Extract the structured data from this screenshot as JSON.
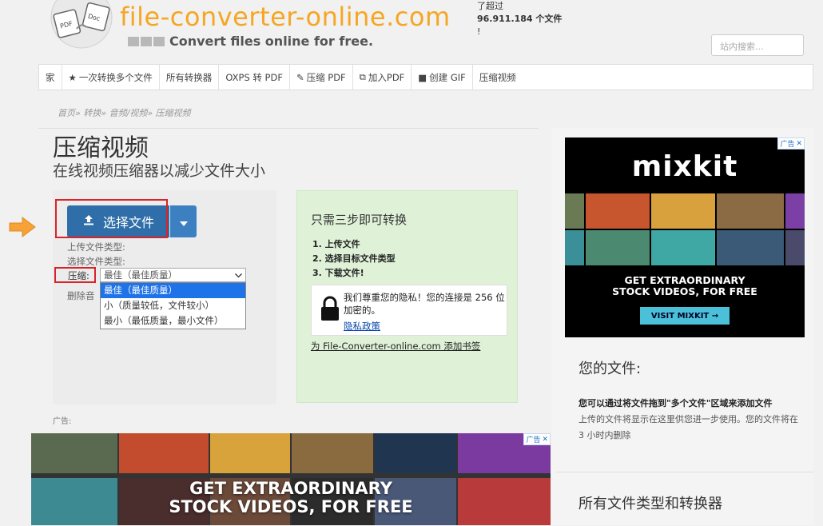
{
  "header": {
    "site_name": "file-converter-online.com",
    "tagline": "Convert files online for free.",
    "stats_line1": "了超过",
    "stats_line2": "96.911.184 个文件",
    "stats_line3": "!",
    "search_placeholder": "站内搜索...",
    "logo_badge_left": "PDF",
    "logo_badge_right": "Doc"
  },
  "nav": {
    "items": [
      {
        "label": "家",
        "icon": ""
      },
      {
        "label": "一次转换多个文件",
        "icon": "star-icon"
      },
      {
        "label": "所有转换器",
        "icon": ""
      },
      {
        "label": "OXPS 转 PDF",
        "icon": ""
      },
      {
        "label": "压缩 PDF",
        "icon": "pin-icon"
      },
      {
        "label": "加入PDF",
        "icon": "copy-icon"
      },
      {
        "label": "创建 GIF",
        "icon": "video-icon"
      },
      {
        "label": "压缩视频",
        "icon": ""
      }
    ]
  },
  "breadcrumb": "首页» 转换» 音频/视频» 压缩视频",
  "main": {
    "title": "压缩视频",
    "subtitle": "在线视频压缩器以减少文件大小",
    "upload_label": "选择文件",
    "upload_file_type_label": "上传文件类型:",
    "target_file_type_label": "选择文件类型:",
    "compress_label": "压缩:",
    "compress_selected": "最佳（最佳质量）",
    "remove_audio_label": "删除音",
    "compress_options": [
      "最佳（最佳质量）",
      "小（质量较低，文件较小）",
      "最小（最低质量，最小文件）"
    ],
    "ad_label": "广告:"
  },
  "steps": {
    "title": "只需三步即可转换",
    "items": [
      "1. 上传文件",
      "2. 选择目标文件类型",
      "3. 下载文件!"
    ],
    "privacy_text": "我们尊重您的隐私！您的连接是 256 位加密的。",
    "privacy_link": "隐私政策",
    "bookmark_link": "为 File-Converter-online.com 添加书签"
  },
  "bottom_ad": {
    "badge": "广告",
    "headline_line1": "GET EXTRAORDINARY",
    "headline_line2": "STOCK VIDEOS, FOR FREE"
  },
  "side_ad": {
    "badge": "广告",
    "logo": "mixkit",
    "headline_line1": "GET EXTRAORDINARY",
    "headline_line2": "STOCK VIDEOS, FOR FREE",
    "cta": "VISIT MIXKIT →"
  },
  "sidebar": {
    "your_files_title": "您的文件:",
    "your_files_bold": "您可以通过将文件拖到\"多个文件\"区域来添加文件",
    "your_files_desc": "上传的文件将显示在这里供您进一步使用。您的文件将在 3 小时内删除",
    "all_types_title": "所有文件类型和转换器"
  },
  "colors": {
    "accent_orange": "#f5a623",
    "button_blue": "#2f6ea8",
    "highlight_red": "#d8232a",
    "steps_green": "#dff2d8",
    "selected_blue": "#1e73e8",
    "cta_cyan": "#4bc0d9"
  }
}
